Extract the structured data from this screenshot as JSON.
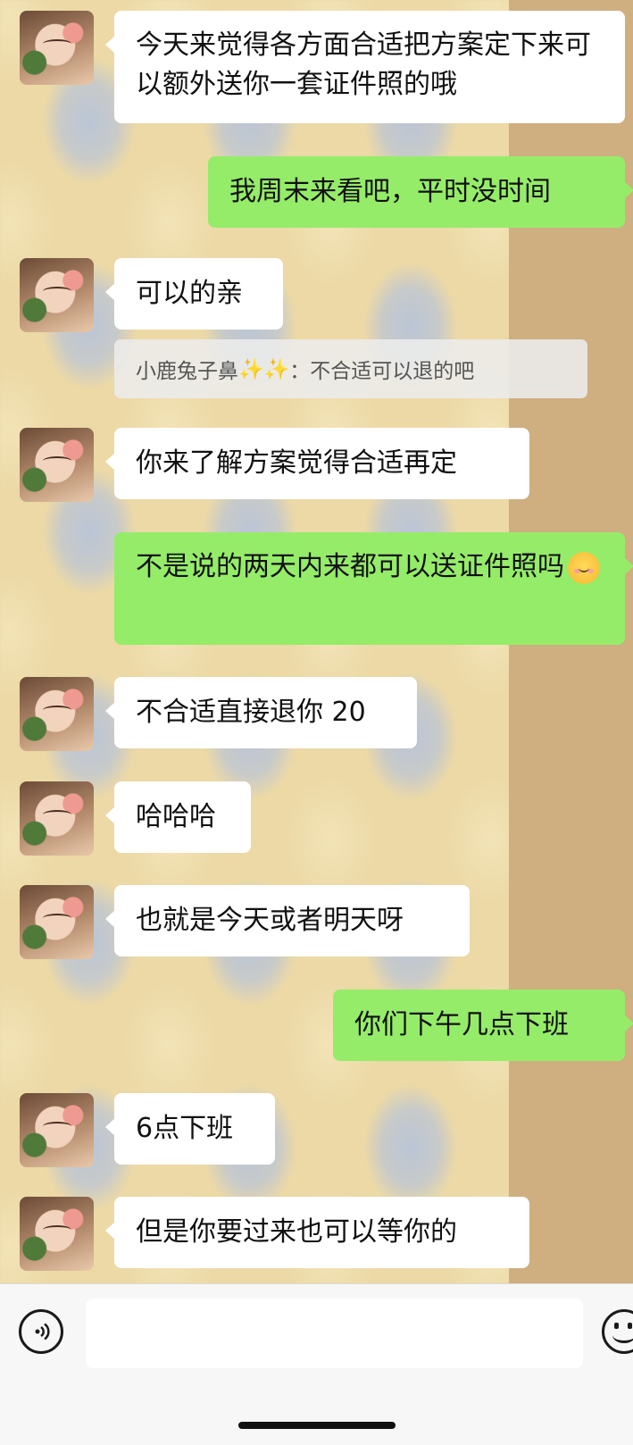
{
  "messages": [
    {
      "side": "in",
      "text": "今天来觉得各方面合适把方案定下来可以额外送你一套证件照的哦"
    },
    {
      "side": "out",
      "text": "我周末来看吧，平时没时间"
    },
    {
      "side": "in",
      "text": "可以的亲"
    },
    {
      "side": "in",
      "text": "你来了解方案觉得合适再定"
    },
    {
      "side": "out",
      "text": "不是说的两天内来都可以送证件照吗",
      "emoji": "smiling-face-with-blush"
    },
    {
      "side": "in",
      "text": "不合适直接退你 20"
    },
    {
      "side": "in",
      "text": "哈哈哈"
    },
    {
      "side": "in",
      "text": "也就是今天或者明天呀"
    },
    {
      "side": "out",
      "text": "你们下午几点下班"
    },
    {
      "side": "in",
      "text": "6点下班"
    },
    {
      "side": "in",
      "text": "但是你要过来也可以等你的"
    }
  ],
  "quote": {
    "sender": "小鹿兔子鼻",
    "sparkles": "✨✨",
    "separator": "：",
    "text": "不合适可以退的吧"
  },
  "input_bar": {
    "value": "",
    "voice_icon": "voice-icon",
    "emoji_icon": "emoji-icon"
  },
  "colors": {
    "outgoing_bubble": "#95ec69",
    "incoming_bubble": "#ffffff"
  }
}
